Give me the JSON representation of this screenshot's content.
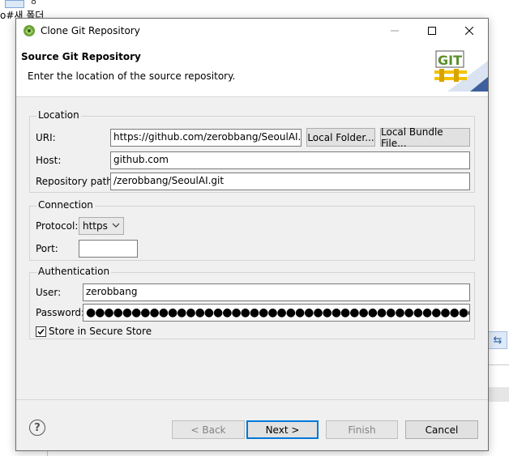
{
  "background": {
    "top_number": "8",
    "top_text": "o#새 폴더"
  },
  "dialog": {
    "title": "Clone Git Repository",
    "banner": {
      "title": "Source Git Repository",
      "description": "Enter the location of the source repository.",
      "logo_text": "GIT"
    },
    "location": {
      "group_label": "Location",
      "uri_label": "URI:",
      "uri_value": "https://github.com/zerobbang/SeoulAI.git",
      "local_folder_button": "Local Folder...",
      "local_bundle_button": "Local Bundle File...",
      "host_label": "Host:",
      "host_value": "github.com",
      "repo_path_label": "Repository path:",
      "repo_path_value": "/zerobbang/SeoulAI.git"
    },
    "connection": {
      "group_label": "Connection",
      "protocol_label": "Protocol:",
      "protocol_value": "https",
      "port_label": "Port:",
      "port_value": ""
    },
    "authentication": {
      "group_label": "Authentication",
      "user_label": "User:",
      "user_value": "zerobbang",
      "password_label": "Password:",
      "password_mask": "●●●●●●●●●●●●●●●●●●●●●●●●●●●●●●●●●●●●●●●●●●●●●●●●●",
      "store_label": "Store in Secure Store",
      "store_checked": true
    },
    "buttons": {
      "help": "?",
      "back": "< Back",
      "next": "Next >",
      "finish": "Finish",
      "cancel": "Cancel"
    },
    "icons": {
      "app": "eclipse-icon",
      "minimize": "minimize-icon",
      "maximize": "maximize-icon",
      "close": "close-icon",
      "help": "help-icon",
      "check": "checkmark-icon"
    },
    "colors": {
      "dialog_bg": "#f0f0f0",
      "default_button_border": "#0078d7",
      "git_logo_green": "#5b8f2a",
      "git_logo_yellow": "#f2c200"
    }
  }
}
